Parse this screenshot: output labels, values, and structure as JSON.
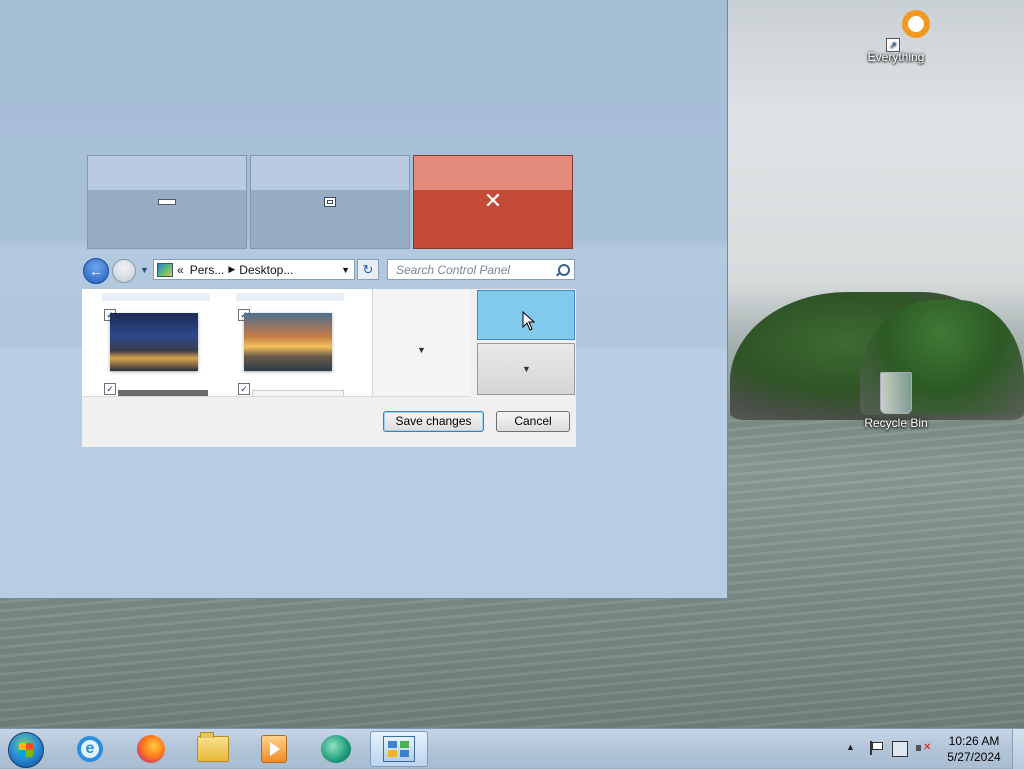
{
  "desktop": {
    "icons": [
      {
        "label": "Everything",
        "icon": "everything-icon"
      },
      {
        "label": "Recycle Bin",
        "icon": "recycle-bin-icon"
      }
    ]
  },
  "window": {
    "caption_buttons": {
      "minimize": "minimize-icon",
      "maximize": "maximize-icon",
      "close": "close-icon"
    },
    "nav": {
      "address_prefix": "«",
      "address_crumbs": [
        "Pers...",
        "Desktop..."
      ],
      "search_placeholder": "Search Control Panel"
    },
    "gallery": {
      "thumbnails": [
        {
          "checked": "✓",
          "image": "city-night-thumbnail"
        },
        {
          "checked": "✓",
          "image": "sunset-harbor-thumbnail"
        }
      ],
      "row2_checks": [
        "✓",
        "✓"
      ]
    },
    "buttons": {
      "save": "Save changes",
      "cancel": "Cancel"
    }
  },
  "taskbar": {
    "pinned": [
      "start-orb",
      "internet-explorer-icon",
      "firefox-icon",
      "file-explorer-icon",
      "media-player-icon",
      "app-icon",
      "control-panel-icon"
    ],
    "clock_time": "10:26 AM",
    "clock_date": "5/27/2024"
  },
  "colors": {
    "close_red": "#c24a36",
    "selection_blue": "#82c9ee",
    "taskbar": "#b1c4d8"
  }
}
